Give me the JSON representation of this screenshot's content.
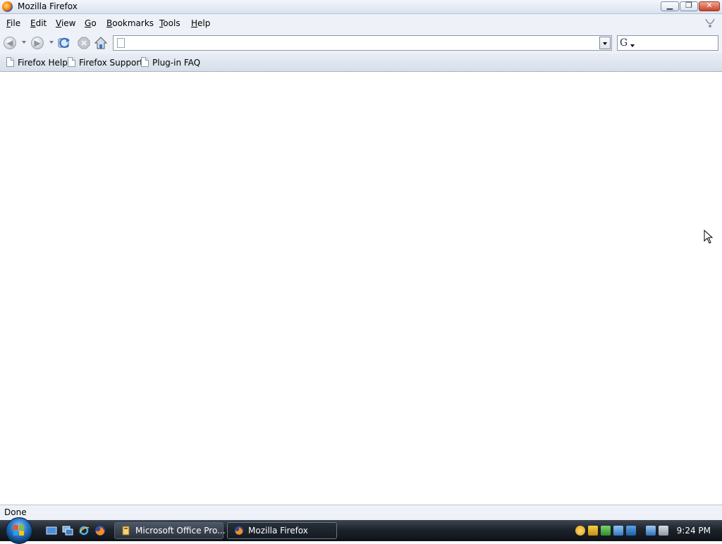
{
  "window": {
    "title": "Mozilla Firefox",
    "buttons": [
      "minimize",
      "maximize",
      "close"
    ]
  },
  "menubar": {
    "items": [
      "File",
      "Edit",
      "View",
      "Go",
      "Bookmarks",
      "Tools",
      "Help"
    ]
  },
  "navigation": {
    "back": "back-icon",
    "forward": "forward-icon",
    "reload": "reload-icon",
    "stop": "stop-icon",
    "home": "home-icon"
  },
  "address_bar": {
    "value": "",
    "placeholder": ""
  },
  "search_bar": {
    "engine_icon": "google-icon",
    "value": "",
    "placeholder": ""
  },
  "bookmarks_toolbar": {
    "items": [
      "Firefox Help",
      "Firefox Support",
      "Plug-in FAQ"
    ]
  },
  "status_bar": {
    "text": "Done"
  },
  "taskbar": {
    "quick_launch": [
      "show-desktop-icon",
      "switch-windows-icon",
      "internet-explorer-icon",
      "firefox-icon"
    ],
    "tasks": [
      {
        "label": "Microsoft Office Pro...",
        "icon": "office-setup-icon",
        "active": false
      },
      {
        "label": "Mozilla Firefox",
        "icon": "firefox-icon",
        "active": true
      }
    ],
    "tray_icons": [
      "windows-live-icon",
      "security-shield-icon",
      "antivirus-icon",
      "network-sharing-icon",
      "network-icon",
      "display-icon",
      "volume-muted-icon"
    ],
    "clock": "9:24 PM"
  },
  "colors": {
    "chrome": "#eef1f7",
    "taskbar": "#1d232b",
    "close_button": "#c9442b"
  }
}
